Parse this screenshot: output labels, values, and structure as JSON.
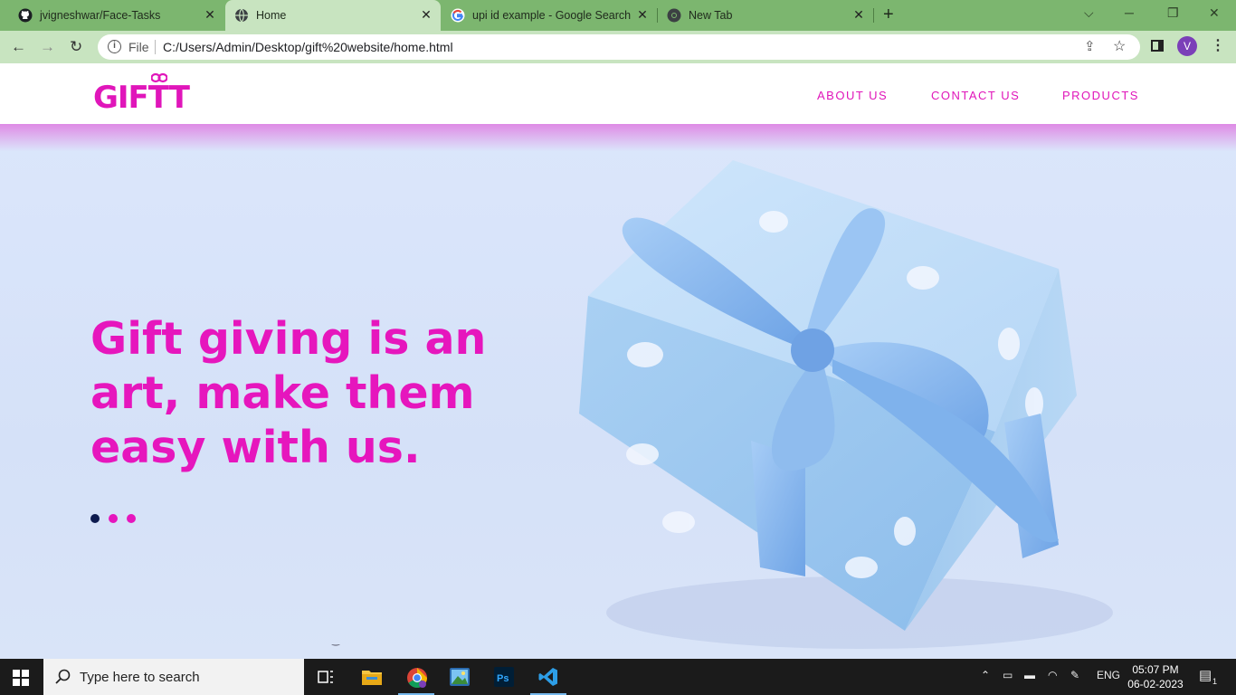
{
  "browser": {
    "tabs": [
      {
        "title": "jvigneshwar/Face-Tasks",
        "icon": "github-icon",
        "active": false
      },
      {
        "title": "Home",
        "icon": "globe-icon",
        "active": true
      },
      {
        "title": "upi id example - Google Search",
        "icon": "google-icon",
        "active": false
      },
      {
        "title": "New Tab",
        "icon": "chrome-icon",
        "active": false
      }
    ],
    "address": {
      "scheme_label": "File",
      "url": "C:/Users/Admin/Desktop/gift%20website/home.html"
    },
    "profile_initial": "V"
  },
  "site": {
    "logo": "GIFTT",
    "nav": [
      "ABOUT US",
      "CONTACT US",
      "PRODUCTS"
    ],
    "hero": {
      "headline": "Gift giving is an art, make them easy with us.",
      "slider": {
        "count": 3,
        "active_index": 0,
        "active_color": "#0d1b4f",
        "inactive_color": "#e616bd"
      }
    },
    "accent_color": "#e016ba"
  },
  "taskbar": {
    "search_placeholder": "Type here to search",
    "apps": [
      "task-view-icon",
      "file-explorer-icon",
      "chrome-icon",
      "photos-icon",
      "photoshop-icon",
      "vscode-icon"
    ],
    "tray": {
      "language": "ENG",
      "time": "05:07 PM",
      "date": "06-02-2023",
      "notifications": "1"
    }
  }
}
